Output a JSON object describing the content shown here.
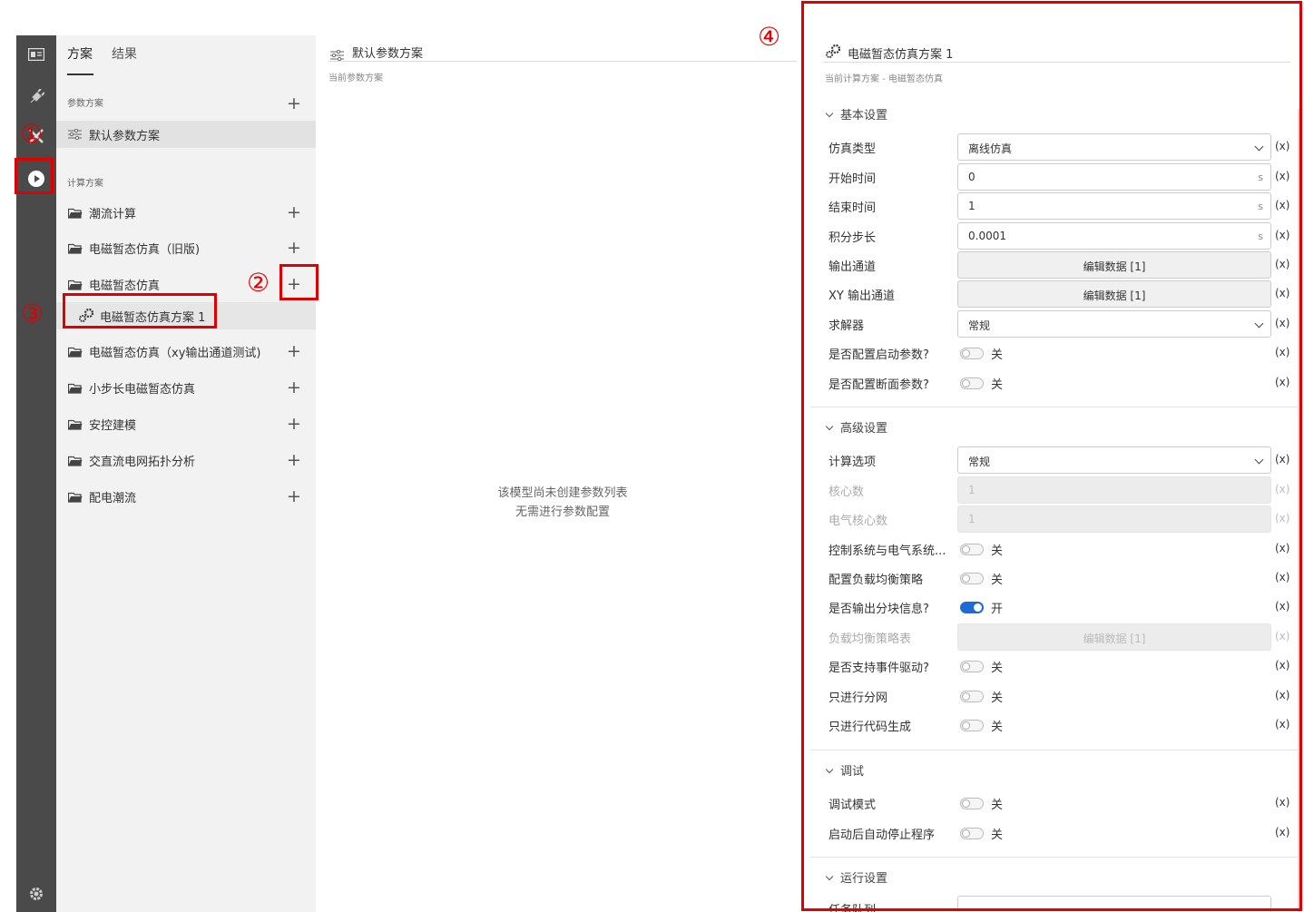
{
  "left_panel": {
    "tabs": [
      "方案",
      "结果"
    ],
    "param_section_label": "参数方案",
    "param_items": [
      "默认参数方案"
    ],
    "calc_section_label": "计算方案",
    "calc_items": [
      "潮流计算",
      "电磁暂态仿真（旧版)",
      "电磁暂态仿真",
      "电磁暂态仿真方案 1",
      "电磁暂态仿真（xy输出通道测试)",
      "小步长电磁暂态仿真",
      "安控建模",
      "交直流电网拓扑分析",
      "配电潮流"
    ]
  },
  "middle_panel": {
    "title": "默认参数方案",
    "subtitle": "当前参数方案",
    "empty_line1": "该模型尚未创建参数列表",
    "empty_line2": "无需进行参数配置"
  },
  "right_panel": {
    "title": "电磁暂态仿真方案 1",
    "subtitle": "当前计算方案 - 电磁暂态仿真",
    "xvar": "(x)",
    "sections": {
      "basic": "基本设置",
      "advanced": "高级设置",
      "debug": "调试",
      "run": "运行设置"
    },
    "basic": {
      "sim_type_label": "仿真类型",
      "sim_type_value": "离线仿真",
      "start_label": "开始时间",
      "start_value": "0",
      "end_label": "结束时间",
      "end_value": "1",
      "step_label": "积分步长",
      "step_value": "0.0001",
      "unit_s": "s",
      "out_label": "输出通道",
      "out_button": "编辑数据 [1]",
      "xy_label": "XY 输出通道",
      "xy_button": "编辑数据 [1]",
      "solver_label": "求解器",
      "solver_value": "常规",
      "startup_label": "是否配置启动参数?",
      "startup_value": "关",
      "section_label": "是否配置断面参数?",
      "section_value": "关"
    },
    "advanced": {
      "calc_opt_label": "计算选项",
      "calc_opt_value": "常规",
      "cores_label": "核心数",
      "cores_value": "1",
      "ecores_label": "电气核心数",
      "ecores_value": "1",
      "ctrl_label": "控制系统与电气系统...",
      "ctrl_value": "关",
      "lb_label": "配置负载均衡策略",
      "lb_value": "关",
      "block_label": "是否输出分块信息?",
      "block_value": "开",
      "lbtable_label": "负载均衡策略表",
      "lbtable_button": "编辑数据 [1]",
      "event_label": "是否支持事件驱动?",
      "event_value": "关",
      "partition_label": "只进行分网",
      "partition_value": "关",
      "codegen_label": "只进行代码生成",
      "codegen_value": "关"
    },
    "debug": {
      "mode_label": "调试模式",
      "mode_value": "关",
      "autostop_label": "启动后自动停止程序",
      "autostop_value": "关"
    },
    "run": {
      "queue_label": "任务队列"
    }
  },
  "annotations": {
    "one": "①",
    "two": "②",
    "three": "③",
    "four": "④"
  },
  "colors": {
    "accent": "#1e6ad6",
    "annotation": "#e00000",
    "rail": "#4a4a4a"
  }
}
